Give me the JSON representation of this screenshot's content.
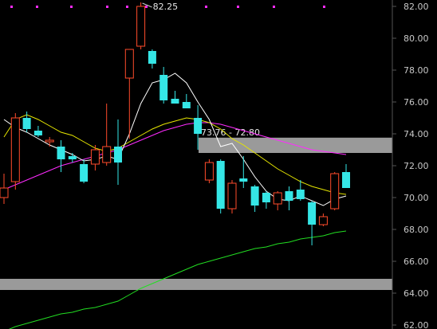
{
  "chart_data": {
    "type": "candlestick",
    "y_ticks": [
      "82.00",
      "80.00",
      "78.00",
      "76.00",
      "74.00",
      "72.00",
      "70.00",
      "68.00",
      "66.00",
      "64.00",
      "62.00"
    ],
    "ylim": [
      61.8,
      82.6
    ],
    "grid": false,
    "colors": {
      "background": "#000000",
      "up": "#ff4b2b",
      "down": "#35e6e6",
      "ma_short": "#ffffff",
      "ma_mid": "#e6e600",
      "ma_long": "#ff2bff",
      "ma_extra": "#22dd22",
      "zone": "#9a9a9a",
      "marker": "#ff2bff",
      "axis": "#555555"
    },
    "candles": [
      {
        "o": 70.0,
        "h": 71.5,
        "l": 69.6,
        "c": 70.6
      },
      {
        "o": 71.0,
        "h": 75.3,
        "l": 70.5,
        "c": 75.0
      },
      {
        "o": 75.0,
        "h": 75.4,
        "l": 74.1,
        "c": 74.3
      },
      {
        "o": 74.2,
        "h": 74.5,
        "l": 73.8,
        "c": 73.9
      },
      {
        "o": 73.5,
        "h": 73.8,
        "l": 73.2,
        "c": 73.6
      },
      {
        "o": 73.2,
        "h": 73.6,
        "l": 71.6,
        "c": 72.4
      },
      {
        "o": 72.6,
        "h": 72.8,
        "l": 72.2,
        "c": 72.4
      },
      {
        "o": 72.1,
        "h": 72.4,
        "l": 70.9,
        "c": 71.0
      },
      {
        "o": 72.1,
        "h": 73.3,
        "l": 71.7,
        "c": 73.0
      },
      {
        "o": 72.2,
        "h": 75.9,
        "l": 72.0,
        "c": 73.2
      },
      {
        "o": 73.2,
        "h": 74.9,
        "l": 70.8,
        "c": 72.2
      },
      {
        "o": 77.5,
        "h": 79.3,
        "l": 73.7,
        "c": 79.3
      },
      {
        "o": 79.5,
        "h": 82.25,
        "l": 79.3,
        "c": 82.0
      },
      {
        "o": 79.2,
        "h": 79.3,
        "l": 78.1,
        "c": 78.4
      },
      {
        "o": 77.7,
        "h": 78.2,
        "l": 75.9,
        "c": 76.1
      },
      {
        "o": 76.2,
        "h": 76.7,
        "l": 75.9,
        "c": 75.9
      },
      {
        "o": 76.0,
        "h": 76.5,
        "l": 75.6,
        "c": 75.6
      },
      {
        "o": 75.0,
        "h": 75.8,
        "l": 73.0,
        "c": 74.0
      },
      {
        "o": 71.1,
        "h": 72.4,
        "l": 70.9,
        "c": 72.2
      },
      {
        "o": 72.3,
        "h": 72.4,
        "l": 69.0,
        "c": 69.3
      },
      {
        "o": 69.3,
        "h": 71.1,
        "l": 69.0,
        "c": 70.9
      },
      {
        "o": 71.2,
        "h": 72.6,
        "l": 70.6,
        "c": 71.0
      },
      {
        "o": 70.7,
        "h": 70.8,
        "l": 69.1,
        "c": 69.5
      },
      {
        "o": 70.3,
        "h": 70.4,
        "l": 69.3,
        "c": 69.7
      },
      {
        "o": 69.6,
        "h": 70.4,
        "l": 69.2,
        "c": 70.3
      },
      {
        "o": 70.4,
        "h": 70.7,
        "l": 69.2,
        "c": 69.8
      },
      {
        "o": 70.5,
        "h": 71.1,
        "l": 69.8,
        "c": 69.9
      },
      {
        "o": 69.7,
        "h": 69.8,
        "l": 67.0,
        "c": 68.3
      },
      {
        "o": 68.3,
        "h": 69.0,
        "l": 68.2,
        "c": 68.8
      },
      {
        "o": 69.3,
        "h": 71.6,
        "l": 69.2,
        "c": 71.5
      },
      {
        "o": 71.6,
        "h": 72.1,
        "l": 70.6,
        "c": 70.6
      }
    ],
    "ma_short": [
      74.9,
      74.4,
      74.1,
      73.7,
      73.3,
      73.0,
      72.7,
      72.3,
      72.4,
      72.6,
      72.4,
      74.0,
      75.9,
      77.2,
      77.4,
      77.8,
      77.2,
      76.0,
      74.9,
      73.2,
      73.4,
      72.4,
      71.3,
      70.4,
      69.9,
      69.8,
      70.1,
      69.8,
      69.5,
      69.9,
      70.1
    ],
    "ma_mid": [
      73.8,
      74.9,
      75.2,
      74.9,
      74.5,
      74.1,
      73.9,
      73.5,
      73.1,
      72.9,
      73.1,
      73.5,
      73.9,
      74.3,
      74.6,
      74.8,
      75.0,
      74.9,
      74.7,
      74.3,
      73.7,
      73.3,
      72.8,
      72.3,
      71.8,
      71.4,
      71.0,
      70.7,
      70.5,
      70.3,
      70.2
    ],
    "ma_long": [
      70.5,
      70.8,
      71.1,
      71.4,
      71.7,
      72.0,
      72.2,
      72.4,
      72.6,
      72.8,
      73.0,
      73.3,
      73.6,
      73.9,
      74.2,
      74.4,
      74.6,
      74.7,
      74.7,
      74.6,
      74.4,
      74.2,
      74.0,
      73.8,
      73.6,
      73.4,
      73.2,
      73.0,
      72.9,
      72.8,
      72.7
    ],
    "ma_extra": [
      61.6,
      61.9,
      62.1,
      62.3,
      62.5,
      62.7,
      62.8,
      63.0,
      63.1,
      63.3,
      63.5,
      63.9,
      64.3,
      64.6,
      64.9,
      65.2,
      65.5,
      65.8,
      66.0,
      66.2,
      66.4,
      66.6,
      66.8,
      66.9,
      67.1,
      67.2,
      67.4,
      67.5,
      67.6,
      67.8,
      67.9
    ],
    "zones": [
      {
        "from": 73.76,
        "to": 72.8,
        "label": "73.76 - 72.80"
      },
      {
        "from": 64.9,
        "to": 64.2,
        "label": ""
      }
    ],
    "high_annotation": {
      "value": 82.25,
      "label": "82.25"
    },
    "top_markers": 10
  }
}
